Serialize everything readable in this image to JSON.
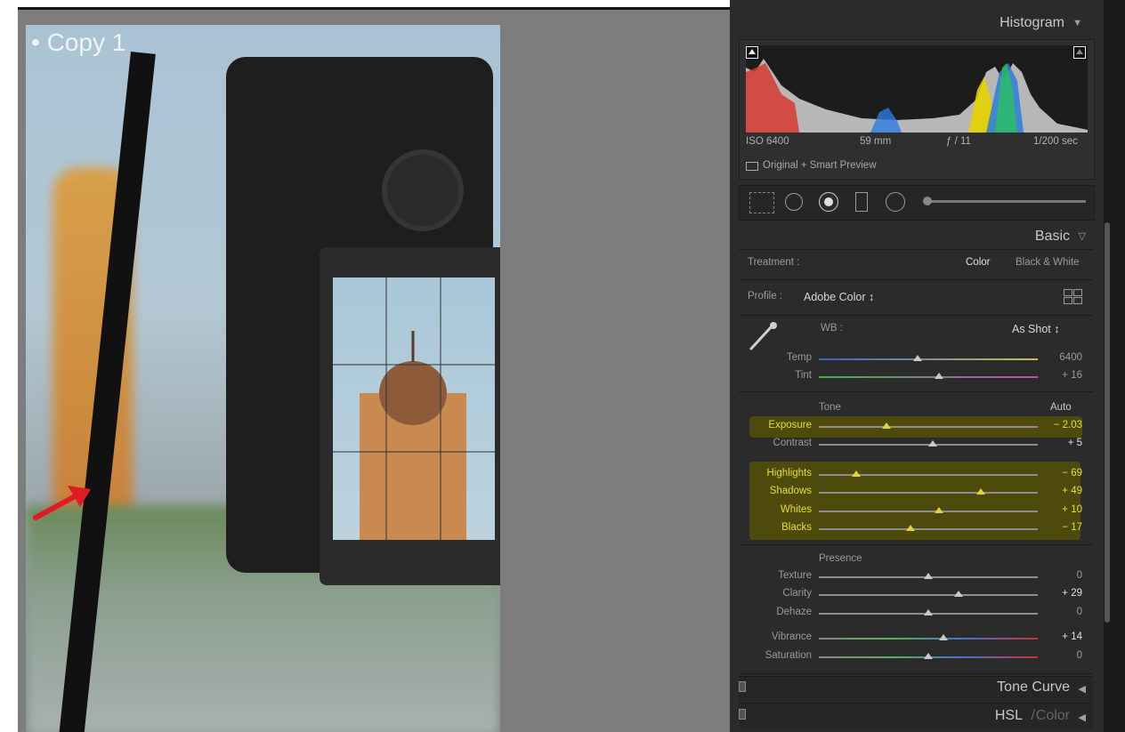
{
  "photo": {
    "label": "• Copy 1"
  },
  "histogram": {
    "title": "Histogram",
    "iso": "ISO 6400",
    "focal": "59 mm",
    "aperture": "ƒ / 11",
    "shutter": "1/200 sec",
    "preview": "Original + Smart Preview"
  },
  "basic": {
    "title": "Basic",
    "treatment_label": "Treatment :",
    "treatment_color": "Color",
    "treatment_bw": "Black & White",
    "profile_label": "Profile :",
    "profile_value": "Adobe Color ↕",
    "wb_label": "WB :",
    "wb_value": "As Shot ↕",
    "tone_label": "Tone",
    "auto_label": "Auto",
    "presence_label": "Presence"
  },
  "sliders": {
    "temp": {
      "label": "Temp",
      "value": "6400",
      "pos": 0.45
    },
    "tint": {
      "label": "Tint",
      "value": "+ 16",
      "pos": 0.55
    },
    "exposure": {
      "label": "Exposure",
      "value": "− 2.03",
      "pos": 0.31
    },
    "contrast": {
      "label": "Contrast",
      "value": "+ 5",
      "pos": 0.52
    },
    "highlights": {
      "label": "Highlights",
      "value": "− 69",
      "pos": 0.17
    },
    "shadows": {
      "label": "Shadows",
      "value": "+ 49",
      "pos": 0.74
    },
    "whites": {
      "label": "Whites",
      "value": "+ 10",
      "pos": 0.55
    },
    "blacks": {
      "label": "Blacks",
      "value": "− 17",
      "pos": 0.42
    },
    "texture": {
      "label": "Texture",
      "value": "0",
      "pos": 0.5
    },
    "clarity": {
      "label": "Clarity",
      "value": "+ 29",
      "pos": 0.64
    },
    "dehaze": {
      "label": "Dehaze",
      "value": "0",
      "pos": 0.5
    },
    "vibrance": {
      "label": "Vibrance",
      "value": "+ 14",
      "pos": 0.57
    },
    "saturation": {
      "label": "Saturation",
      "value": "0",
      "pos": 0.5
    }
  },
  "sections": {
    "tone_curve": "Tone Curve",
    "hsl": "HSL",
    "color": "Color"
  },
  "colors": {
    "highlight": "#4d4a0c",
    "highlight_text": "#e6df3a",
    "panel": "#2b2b2b"
  }
}
